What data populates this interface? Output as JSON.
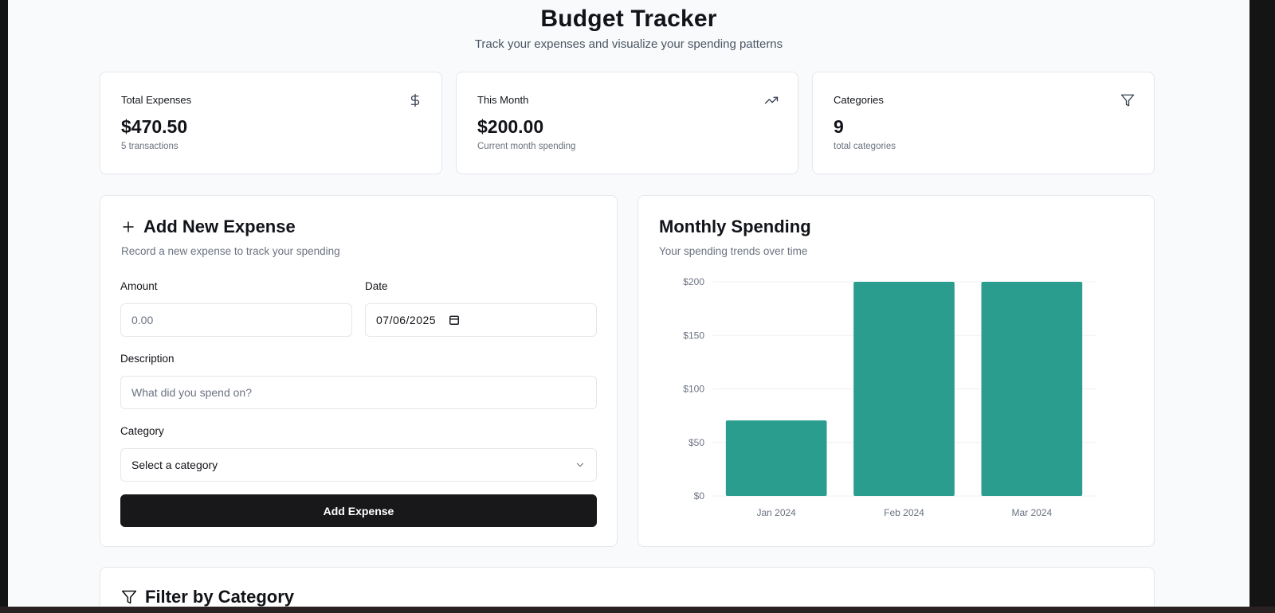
{
  "header": {
    "title": "Budget Tracker",
    "subtitle": "Track your expenses and visualize your spending patterns"
  },
  "stats": [
    {
      "label": "Total Expenses",
      "value": "$470.50",
      "note": "5 transactions",
      "icon": "dollar-icon"
    },
    {
      "label": "This Month",
      "value": "$200.00",
      "note": "Current month spending",
      "icon": "trending-up-icon"
    },
    {
      "label": "Categories",
      "value": "9",
      "note": "total categories",
      "icon": "filter-icon"
    }
  ],
  "form": {
    "title": "Add New Expense",
    "description": "Record a new expense to track your spending",
    "amount_label": "Amount",
    "amount_placeholder": "0.00",
    "date_label": "Date",
    "date_value": "07/06/2025",
    "description_label": "Description",
    "description_placeholder": "What did you spend on?",
    "category_label": "Category",
    "category_placeholder": "Select a category",
    "submit_label": "Add Expense"
  },
  "chart_card": {
    "title": "Monthly Spending",
    "description": "Your spending trends over time"
  },
  "filter_card": {
    "title": "Filter by Category"
  },
  "colors": {
    "bar": "#2a9d8f",
    "accent_dark": "#18181b"
  },
  "chart_data": {
    "type": "bar",
    "categories": [
      "Jan 2024",
      "Feb 2024",
      "Mar 2024"
    ],
    "values": [
      70.5,
      200,
      200
    ],
    "ylim": [
      0,
      200
    ],
    "yticks": [
      0,
      50,
      100,
      150,
      200
    ],
    "ytick_labels": [
      "$0",
      "$50",
      "$100",
      "$150",
      "$200"
    ],
    "grid": true,
    "legend": "none"
  }
}
